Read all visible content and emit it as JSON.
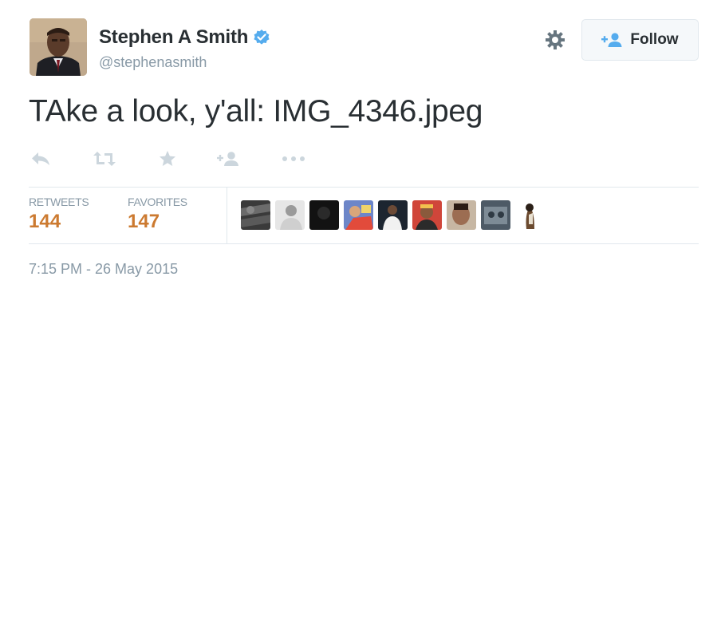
{
  "author": {
    "name": "Stephen A Smith",
    "handle": "@stephenasmith",
    "verified": true,
    "avatar_icon": "profile-photo"
  },
  "header": {
    "settings_icon": "gear-icon",
    "follow_label": "Follow",
    "follow_icon": "add-user-icon"
  },
  "tweet": {
    "text": "TAke a look, y'all: IMG_4346.jpeg"
  },
  "actions": [
    {
      "name": "reply",
      "icon": "reply-icon"
    },
    {
      "name": "retweet",
      "icon": "retweet-icon"
    },
    {
      "name": "favorite",
      "icon": "star-icon"
    },
    {
      "name": "follow",
      "icon": "add-user-icon"
    },
    {
      "name": "more",
      "icon": "more-icon"
    }
  ],
  "stats": {
    "retweets_label": "RETWEETS",
    "retweets_count": "144",
    "favorites_label": "FAVORITES",
    "favorites_count": "147"
  },
  "favorited_by_count_shown": 9,
  "timestamp": "7:15 PM - 26 May 2015",
  "colors": {
    "stat_value": "#cc7a30",
    "verified_badge": "#55acee",
    "muted_text": "#8899a6",
    "follow_icon": "#55acee"
  }
}
